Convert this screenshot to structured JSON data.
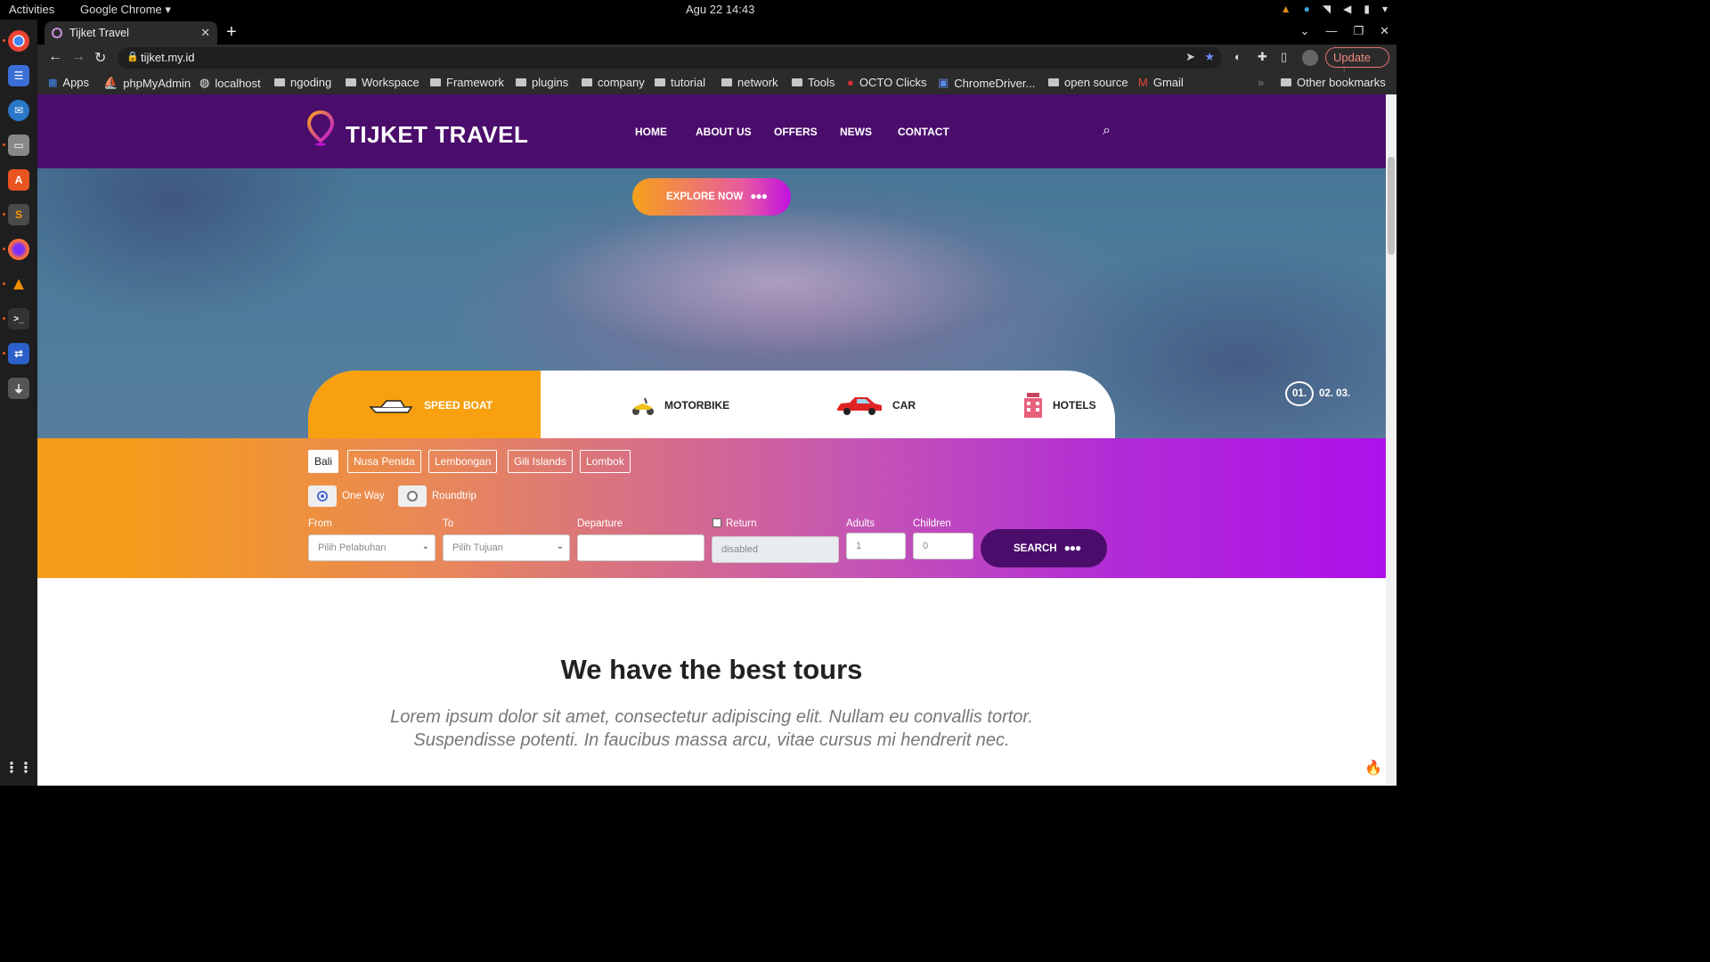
{
  "topbar": {
    "activities": "Activities",
    "app": "Google Chrome ▾",
    "clock": "Agu 22  14:43"
  },
  "browser": {
    "tab_title": "Tijket Travel",
    "url": "tijket.my.id",
    "update_label": "Update",
    "bookmarks": [
      "Apps",
      "phpMyAdmin",
      "localhost",
      "ngoding",
      "Workspace",
      "Framework",
      "plugins",
      "company",
      "tutorial",
      "network",
      "Tools",
      "OCTO Clicks",
      "ChromeDriver...",
      "open source",
      "Gmail"
    ],
    "other_bookmarks": "Other bookmarks"
  },
  "site": {
    "logo": "TIJKET TRAVEL",
    "nav": [
      "HOME",
      "ABOUT US",
      "OFFERS",
      "NEWS",
      "CONTACT"
    ],
    "explore": "EXPLORE NOW",
    "slides": {
      "active": "01.",
      "others": "02. 03."
    },
    "categories": [
      "SPEED BOAT",
      "MOTORBIKE",
      "CAR",
      "HOTELS"
    ],
    "islands": [
      "Bali",
      "Nusa Penida",
      "Lembongan",
      "Gili Islands",
      "Lombok"
    ],
    "trip_types": [
      "One Way",
      "Roundtrip"
    ],
    "fields": {
      "from_label": "From",
      "from_value": "Pilih Pelabuhan",
      "to_label": "To",
      "to_value": "Pilih Tujuan",
      "departure_label": "Departure",
      "return_label": "Return",
      "return_value": "disabled",
      "adults_label": "Adults",
      "adults_value": "1",
      "children_label": "Children",
      "children_value": "0"
    },
    "search": "SEARCH",
    "tours_title": "We have the best tours",
    "tours_desc": "Lorem ipsum dolor sit amet, consectetur adipiscing elit. Nullam eu convallis tortor. Suspendisse potenti. In faucibus massa arcu, vitae cursus mi hendrerit nec."
  },
  "colors": {
    "nav_purple": "#4a0d6b",
    "accent_orange": "#f8a00f",
    "accent_magenta": "#ae10ea"
  }
}
